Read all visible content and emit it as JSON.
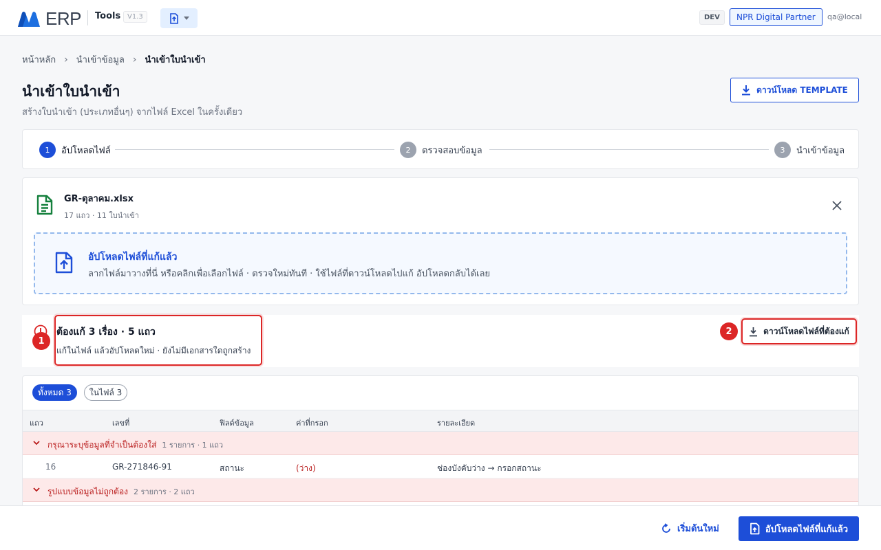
{
  "header": {
    "logo_text": "ERP",
    "app_name": "Tools",
    "version": "V1.3",
    "env": "DEV",
    "partner": "NPR Digital Partner",
    "user": "qa@local"
  },
  "breadcrumb": [
    "หน้าหลัก",
    "นำเข้าข้อมูล",
    "นำเข้าใบนำเข้า"
  ],
  "page": {
    "title": "นำเข้าใบนำเข้า",
    "subtitle": "สร้างใบนำเข้า (ประเภทอื่นๆ) จากไฟล์ Excel ในครั้งเดียว",
    "template_button": "ดาวน์โหลด TEMPLATE"
  },
  "stepper": {
    "steps": [
      {
        "num": "1",
        "label": "อัปโหลดไฟล์"
      },
      {
        "num": "2",
        "label": "ตรวจสอบข้อมูล"
      },
      {
        "num": "3",
        "label": "นำเข้าข้อมูล"
      }
    ]
  },
  "file": {
    "name": "GR-ตุลาคม.xlsx",
    "meta": "17 แถว · 11 ใบนำเข้า"
  },
  "dropzone": {
    "title": "อัปโหลดไฟล์ที่แก้แล้ว",
    "desc": "ลากไฟล์มาวางที่นี่ หรือคลิกเพื่อเลือกไฟล์ · ตรวจใหม่ทันที · ใช้ไฟล์ที่ดาวน์โหลดไปแก้ อัปโหลดกลับได้เลย"
  },
  "errors": {
    "title": "ต้องแก้ 3 เรื่อง · 5 แถว",
    "desc": "แก้ในไฟล์ แล้วอัปโหลดใหม่ · ยังไม่มีเอกสารใดถูกสร้าง",
    "download_button": "ดาวน์โหลดไฟล์ที่ต้องแก้",
    "marker1": "1",
    "marker2": "2"
  },
  "filters": {
    "all": "ทั้งหมด 3",
    "in_file": "ในไฟล์ 3"
  },
  "table": {
    "headers": [
      "แถว",
      "เลขที่",
      "ฟิลด์ข้อมูล",
      "ค่าที่กรอก",
      "รายละเอียด"
    ],
    "groups": [
      {
        "title": "กรุณาระบุข้อมูลที่จำเป็นต้องใส่",
        "count": "1 รายการ · 1 แถว",
        "rows": [
          {
            "row": "16",
            "doc": "GR-271846-91",
            "field": "สถานะ",
            "value": "(ว่าง)",
            "detail": "ช่องบังคับว่าง → กรอกสถานะ"
          }
        ]
      },
      {
        "title": "รูปแบบข้อมูลไม่ถูกต้อง",
        "count": "2 รายการ · 2 แถว",
        "rows": []
      }
    ]
  },
  "footer": {
    "restart": "เริ่มต้นใหม่",
    "upload": "อัปโหลดไฟล์ที่แก้แล้ว"
  },
  "colors": {
    "primary": "#1d4ed8",
    "error": "#dc2626",
    "error_bg": "#fde9e9"
  }
}
